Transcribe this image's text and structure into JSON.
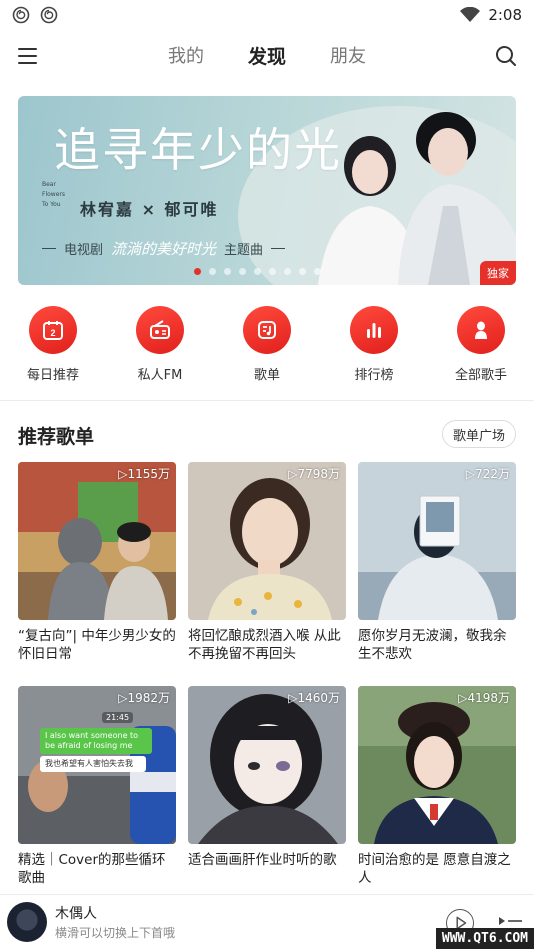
{
  "status_bar": {
    "time": "2:08"
  },
  "header": {
    "tabs": [
      {
        "label": "我的",
        "active": false
      },
      {
        "label": "发现",
        "active": true
      },
      {
        "label": "朋友",
        "active": false
      }
    ]
  },
  "banner": {
    "title": "追寻年少的光",
    "side_text": "Bear Flowers To You",
    "artists": "林宥嘉 × 郁可唯",
    "subtitle_left": "电视剧",
    "subtitle_script": "流淌的美好时光",
    "subtitle_right": "主题曲",
    "badge": "独家",
    "dot_count": 9,
    "active_dot": 0
  },
  "shortcuts": [
    {
      "label": "每日推荐",
      "icon": "calendar-icon",
      "icon_text": "2"
    },
    {
      "label": "私人FM",
      "icon": "radio-icon"
    },
    {
      "label": "歌单",
      "icon": "playlist-icon"
    },
    {
      "label": "排行榜",
      "icon": "chart-bars-icon"
    },
    {
      "label": "全部歌手",
      "icon": "singer-icon"
    }
  ],
  "section": {
    "title": "推荐歌单",
    "more_label": "歌单广场"
  },
  "playlists": [
    {
      "plays": "1155万",
      "title": "“复古向”| 中年少男少女的怀旧日常"
    },
    {
      "plays": "7798万",
      "title": "将回忆酿成烈酒入喉 从此不再挽留不再回头"
    },
    {
      "plays": "722万",
      "title": "愿你岁月无波澜，敬我余生不悲欢"
    },
    {
      "plays": "1982万",
      "title": "精选｜Cover的那些循环歌曲"
    },
    {
      "plays": "1460万",
      "title": "适合画画肝作业时听的歌"
    },
    {
      "plays": "4198万",
      "title": "时间治愈的是 愿意自渡之人"
    }
  ],
  "chat_overlay": {
    "time": "21:45",
    "bubble_1": "I also want someone to be afraid of losing me",
    "bubble_2": "我也希望有人害怕失去我"
  },
  "player": {
    "song": "木偶人",
    "hint": "横滑可以切换上下首哦"
  },
  "watermark": "WWW.QT6.COM",
  "colors": {
    "accent": "#e6312a"
  }
}
